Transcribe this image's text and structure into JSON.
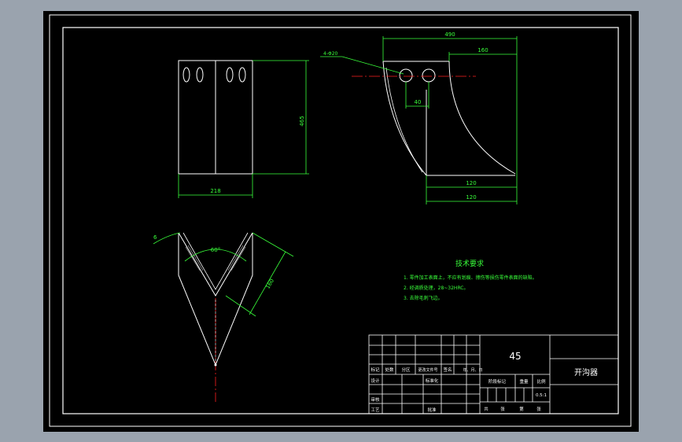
{
  "canvas": {
    "background": "#000000",
    "frame_color": "#9aa3ae",
    "line_color": "#ffffff",
    "dimension_color": "#39ff3a",
    "centerline_color": "#ff2020",
    "title_text_color": "#ffffff"
  },
  "front_view": {
    "width_dim": "218",
    "height_dim": "465"
  },
  "side_view": {
    "top_dim": "490",
    "top_right_dim": "160",
    "hole_callout": "4-Φ20",
    "hole_spacing_dim": "40",
    "bottom_inner_dim": "120",
    "bottom_outer_dim": "120"
  },
  "section_view": {
    "angle_dim": "60°",
    "thickness_dim": "6",
    "length_dim": "160"
  },
  "technical_requirements": {
    "title": "技术要求",
    "items": [
      "1. 零件加工表面上，不应有划痕、擦伤等损伤零件表面的缺陷。",
      "2. 经调质处理，28~32HRC。",
      "3. 去除毛刺飞边。"
    ]
  },
  "title_block": {
    "material": "45",
    "part_name": "开沟器",
    "header_labels": [
      "标记",
      "处数",
      "分区",
      "更改文件号",
      "签名",
      "年、月、日"
    ],
    "row_labels": [
      "设计",
      "审核",
      "工艺"
    ],
    "standard_label": "标准化",
    "approve_label": "批准",
    "stage_label": "阶段标记",
    "weight_label": "重量",
    "scale_label": "比例",
    "scale_value": "0.5:1",
    "sheet_labels": [
      "共",
      "张",
      "第",
      "张"
    ]
  }
}
